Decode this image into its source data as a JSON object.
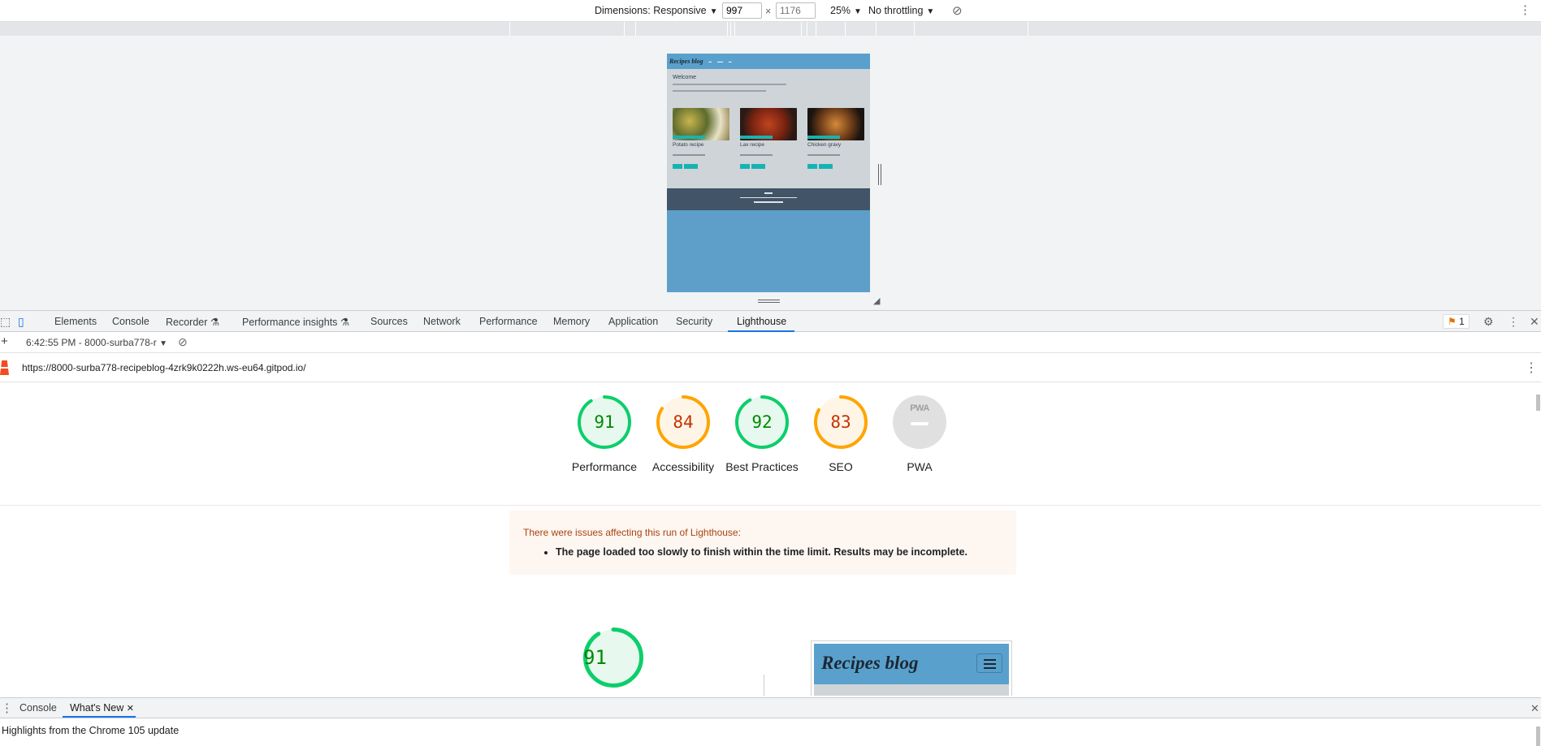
{
  "device_toolbar": {
    "dimensions_label": "Dimensions: Responsive",
    "width_value": "997",
    "height_value": "1176",
    "zoom": "25%",
    "throttling": "No throttling"
  },
  "preview": {
    "brand": "Recipes blog",
    "welcome": "Welcome",
    "cards": [
      {
        "title": "Potato recipe"
      },
      {
        "title": "Lax recipe"
      },
      {
        "title": "Chicken gravy"
      }
    ]
  },
  "devtools": {
    "tabs": [
      "Elements",
      "Console",
      "Recorder",
      "Performance insights",
      "Sources",
      "Network",
      "Performance",
      "Memory",
      "Application",
      "Security",
      "Lighthouse"
    ],
    "issues_count": "1"
  },
  "lighthouse": {
    "report_selector": "6:42:55 PM - 8000-surba778-r",
    "url": "https://8000-surba778-recipeblog-4zrk9k0222h.ws-eu64.gitpod.io/",
    "scores": [
      {
        "value": "91",
        "label": "Performance",
        "color": "#0cce6b",
        "text_color": "#008800",
        "fraction": 0.91
      },
      {
        "value": "84",
        "label": "Accessibility",
        "color": "#ffa400",
        "text_color": "#c33300",
        "fraction": 0.84
      },
      {
        "value": "92",
        "label": "Best Practices",
        "color": "#0cce6b",
        "text_color": "#008800",
        "fraction": 0.92
      },
      {
        "value": "83",
        "label": "SEO",
        "color": "#ffa400",
        "text_color": "#c33300",
        "fraction": 0.83
      }
    ],
    "pwa": {
      "badge": "PWA",
      "label": "PWA"
    },
    "warning": {
      "title": "There were issues affecting this run of Lighthouse:",
      "items": [
        "The page loaded too slowly to finish within the time limit. Results may be incomplete."
      ]
    },
    "performance_detail": {
      "value": "91",
      "fraction": 0.91
    },
    "screenshot_brand": "Recipes blog"
  },
  "drawer": {
    "tabs": [
      "Console",
      "What's New"
    ],
    "highlight": "Highlights from the Chrome 105 update"
  }
}
